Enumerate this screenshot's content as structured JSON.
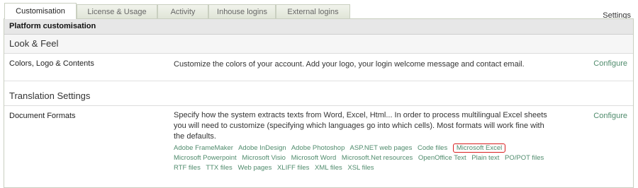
{
  "tabs": [
    "Customisation",
    "License & Usage",
    "Activity",
    "Inhouse logins",
    "External logins"
  ],
  "settings_label": "Settings",
  "panel_header": "Platform customisation",
  "sections": {
    "look_feel": "Look & Feel",
    "translation": "Translation Settings"
  },
  "colors_row": {
    "name": "Colors, Logo & Contents",
    "description": "Customize the colors of your account. Add your logo, your login welcome message and contact email.",
    "action": "Configure"
  },
  "formats_row": {
    "name": "Document Formats",
    "description": "Specify how the system extracts texts from Word, Excel, Html... In order to process multilingual Excel sheets you will need to customize (specifying which languages go into which cells). Most formats will work fine with the defaults.",
    "action": "Configure",
    "formats": [
      "Adobe FrameMaker",
      "Adobe InDesign",
      "Adobe Photoshop",
      "ASP.NET web pages",
      "Code files",
      "Microsoft Excel",
      "Microsoft Powerpoint",
      "Microsoft Visio",
      "Microsoft Word",
      "Microsoft.Net resources",
      "OpenOffice Text",
      "Plain text",
      "PO/POT files",
      "RTF files",
      "TTX files",
      "Web pages",
      "XLIFF files",
      "XML files",
      "XSL files"
    ]
  }
}
